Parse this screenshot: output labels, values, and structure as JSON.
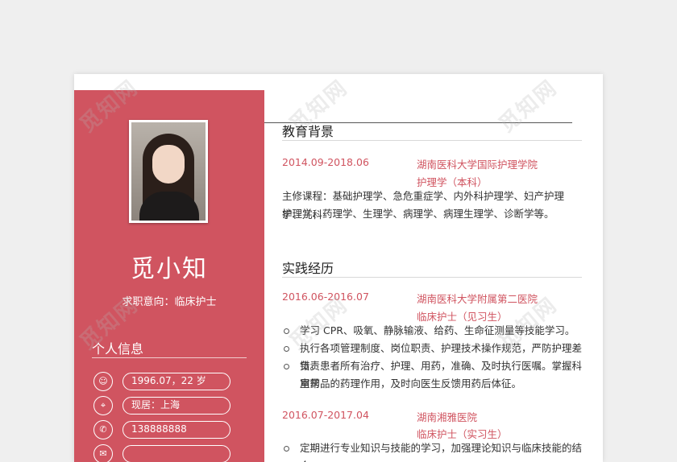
{
  "profile": {
    "name": "觅小知",
    "intent": "求职意向：临床护士",
    "info_title": "个人信息",
    "info": [
      {
        "icon": "person-icon",
        "glyph": "☺",
        "text": "1996.07，22 岁"
      },
      {
        "icon": "location-pin-icon",
        "glyph": "⌖",
        "text": "现居：上海"
      },
      {
        "icon": "phone-icon",
        "glyph": "✆",
        "text": "138888888"
      },
      {
        "icon": "mail-icon",
        "glyph": "✉",
        "text": ""
      }
    ]
  },
  "education": {
    "title": "教育背景",
    "date": "2014.09-2018.06",
    "school": "湖南医科大学国际护理学院",
    "major": "护理学（本科）",
    "courses_line1": "主修课程：基础护理学、急危重症学、内外科护理学、妇产护理学、儿科",
    "courses_line2": "护理学、药理学、生理学、病理学、病理生理学、诊断学等。"
  },
  "practice": {
    "title": "实践经历",
    "job1": {
      "date": "2016.06-2016.07",
      "org": "湖南医科大学附属第二医院",
      "role": "临床护士（见习生）",
      "bullets": [
        "学习 CPR、吸氧、静脉输液、给药、生命征测量等技能学习。",
        "执行各项管理制度、岗位职责、护理技术操作规范，严防护理差错。",
        "负责患者所有治疗、护理、用药，准确、及时执行医嘱。掌握科室常",
        "用药品的药理作用，及时向医生反馈用药后体征。"
      ]
    },
    "job2": {
      "date": "2016.07-2017.04",
      "org": "湖南湘雅医院",
      "role": "临床护士（实习生）",
      "bullets": [
        "定期进行专业知识与技能的学习，加强理论知识与临床技能的结合，"
      ]
    }
  },
  "watermark": "觅知网",
  "colors": {
    "accent": "#d05460",
    "paper": "#ffffff",
    "background": "#efefef"
  }
}
